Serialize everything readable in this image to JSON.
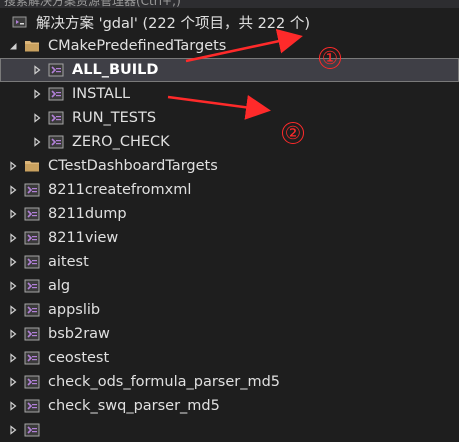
{
  "colors": {
    "background": "#1e1e1e",
    "selected_bg": "#3f3f46",
    "project_icon": "#b180d7",
    "folder_icon": "#dcb67a",
    "annotation": "#ff2a2a"
  },
  "header_cut_text": "搜索解决方案资源管理器(Ctrl+;)",
  "solution": {
    "label": "解决方案 'gdal' (222 个项目，共 222 个)",
    "icon": "solution-icon"
  },
  "tree": [
    {
      "label": "CMakePredefinedTargets",
      "type": "folder",
      "depth": 0,
      "expanded": true,
      "selected": false
    },
    {
      "label": "ALL_BUILD",
      "type": "project",
      "depth": 1,
      "expanded": false,
      "selected": true
    },
    {
      "label": "INSTALL",
      "type": "project",
      "depth": 1,
      "expanded": false,
      "selected": false
    },
    {
      "label": "RUN_TESTS",
      "type": "project",
      "depth": 1,
      "expanded": false,
      "selected": false
    },
    {
      "label": "ZERO_CHECK",
      "type": "project",
      "depth": 1,
      "expanded": false,
      "selected": false
    },
    {
      "label": "CTestDashboardTargets",
      "type": "folder",
      "depth": 0,
      "expanded": false,
      "selected": false
    },
    {
      "label": "8211createfromxml",
      "type": "project",
      "depth": 0,
      "expanded": false,
      "selected": false
    },
    {
      "label": "8211dump",
      "type": "project",
      "depth": 0,
      "expanded": false,
      "selected": false
    },
    {
      "label": "8211view",
      "type": "project",
      "depth": 0,
      "expanded": false,
      "selected": false
    },
    {
      "label": "aitest",
      "type": "project",
      "depth": 0,
      "expanded": false,
      "selected": false
    },
    {
      "label": "alg",
      "type": "project",
      "depth": 0,
      "expanded": false,
      "selected": false
    },
    {
      "label": "appslib",
      "type": "project",
      "depth": 0,
      "expanded": false,
      "selected": false
    },
    {
      "label": "bsb2raw",
      "type": "project",
      "depth": 0,
      "expanded": false,
      "selected": false
    },
    {
      "label": "ceostest",
      "type": "project",
      "depth": 0,
      "expanded": false,
      "selected": false
    },
    {
      "label": "check_ods_formula_parser_md5",
      "type": "project",
      "depth": 0,
      "expanded": false,
      "selected": false
    },
    {
      "label": "check_swq_parser_md5",
      "type": "project",
      "depth": 0,
      "expanded": false,
      "selected": false
    },
    {
      "label": "",
      "type": "project",
      "depth": 0,
      "expanded": false,
      "selected": false
    }
  ],
  "annotations": [
    {
      "number": "①"
    },
    {
      "number": "②"
    }
  ]
}
